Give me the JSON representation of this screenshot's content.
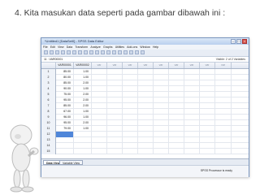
{
  "heading": "4.  Kita masukan data seperti pada gambar dibawah ini :",
  "window": {
    "title": "*Untitled1 [DataSet0] - SPSS Data Editor",
    "menu": [
      "File",
      "Edit",
      "View",
      "Data",
      "Transform",
      "Analyze",
      "Graphs",
      "Utilities",
      "Add-ons",
      "Window",
      "Help"
    ],
    "cell_ref": "11 : VAR00001",
    "visible_label": "Visible: 2 of 2 Variables",
    "columns": [
      "VAR00001",
      "VAR00002",
      "var",
      "var",
      "var",
      "var",
      "var",
      "var",
      "var",
      "var",
      "var"
    ],
    "rows": [
      [
        "1",
        "85.00",
        "1.00"
      ],
      [
        "2",
        "80.00",
        "1.00"
      ],
      [
        "3",
        "85.00",
        "2.00"
      ],
      [
        "4",
        "90.00",
        "1.00"
      ],
      [
        "5",
        "75.00",
        "2.00"
      ],
      [
        "6",
        "95.00",
        "2.00"
      ],
      [
        "7",
        "85.00",
        "2.00"
      ],
      [
        "8",
        "67.00",
        "1.00"
      ],
      [
        "9",
        "96.00",
        "1.00"
      ],
      [
        "10",
        "95.00",
        "2.00"
      ],
      [
        "11",
        "79.00",
        "1.00"
      ],
      [
        "12",
        "",
        ""
      ],
      [
        "13",
        "",
        ""
      ],
      [
        "14",
        "",
        ""
      ],
      [
        "15",
        "",
        ""
      ]
    ],
    "tabs": [
      "Data View",
      "Variable View"
    ],
    "status": "SPSS  Processor is ready"
  }
}
